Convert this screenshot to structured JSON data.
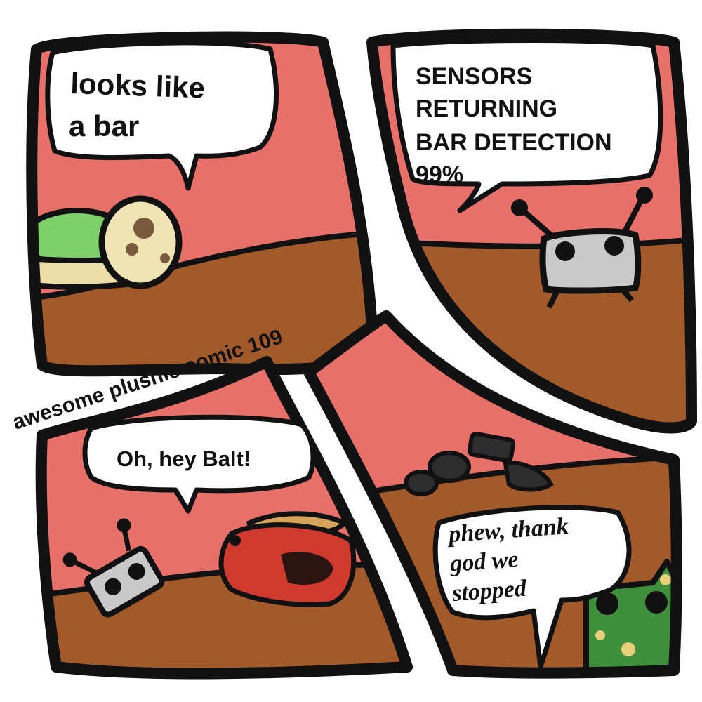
{
  "comic": {
    "title": "awesome plushie comic 109",
    "colors": {
      "sky": "#e8706a",
      "floor": "#a25a2a",
      "outline": "#111111",
      "bubble": "#ffffff",
      "robot": "#c9c9c9",
      "frog": "#3f8f3c",
      "frog_spots": "#e6d07a",
      "turtle": "#d03a2e",
      "turtle_shell": "#d6a35a",
      "egg": "#efe4b4",
      "shell_green": "#7ed06a"
    }
  },
  "panels": [
    {
      "label": "panel-1",
      "speech": {
        "lines": [
          "looks like",
          "a bar"
        ]
      }
    },
    {
      "label": "panel-2",
      "speech": {
        "lines": [
          "SENSORS",
          "RETURNING",
          "BAR DETECTION",
          "99%"
        ]
      }
    },
    {
      "label": "panel-3",
      "speech": {
        "lines": [
          "Oh, hey Balt!"
        ]
      }
    },
    {
      "label": "panel-4",
      "speech": {
        "lines": [
          "phew, thank",
          "god we",
          "stopped"
        ]
      }
    }
  ]
}
